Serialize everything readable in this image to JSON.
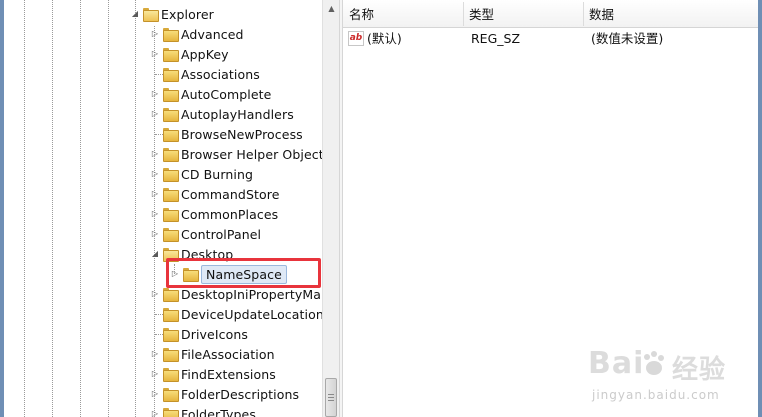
{
  "tree": {
    "parent": "Explorer",
    "items": [
      {
        "label": "Advanced",
        "expandable": true
      },
      {
        "label": "AppKey",
        "expandable": true
      },
      {
        "label": "Associations",
        "expandable": false
      },
      {
        "label": "AutoComplete",
        "expandable": true
      },
      {
        "label": "AutoplayHandlers",
        "expandable": true
      },
      {
        "label": "BrowseNewProcess",
        "expandable": false
      },
      {
        "label": "Browser Helper Objects",
        "expandable": true
      },
      {
        "label": "CD Burning",
        "expandable": true
      },
      {
        "label": "CommandStore",
        "expandable": true
      },
      {
        "label": "CommonPlaces",
        "expandable": true
      },
      {
        "label": "ControlPanel",
        "expandable": true
      },
      {
        "label": "Desktop",
        "expandable": true,
        "expanded": true
      },
      {
        "label": "NameSpace",
        "expandable": true,
        "selected": true,
        "child": true
      },
      {
        "label": "DesktopIniPropertyMap",
        "expandable": true
      },
      {
        "label": "DeviceUpdateLocations",
        "expandable": false
      },
      {
        "label": "DriveIcons",
        "expandable": false
      },
      {
        "label": "FileAssociation",
        "expandable": true
      },
      {
        "label": "FindExtensions",
        "expandable": true
      },
      {
        "label": "FolderDescriptions",
        "expandable": true
      },
      {
        "label": "FolderTypes",
        "expandable": true
      }
    ]
  },
  "list": {
    "columns": [
      "名称",
      "类型",
      "数据"
    ],
    "rows": [
      {
        "name": "(默认)",
        "type": "REG_SZ",
        "data": "(数值未设置)",
        "icon": "string-value-icon"
      }
    ]
  },
  "watermark": {
    "text": "Bai 经验",
    "sub": "jingyan.baidu.com"
  }
}
